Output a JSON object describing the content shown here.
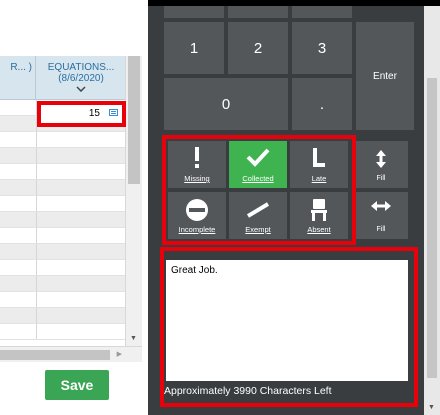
{
  "gradebook": {
    "left_column_header": "R... )",
    "column_header_title": "EQUATIONS...",
    "column_header_date": "(8/6/2020)",
    "selected_score": "15",
    "save_label": "Save"
  },
  "keypad": {
    "keys": [
      "1",
      "2",
      "3",
      "0",
      "."
    ],
    "enter_label": "Enter"
  },
  "status_buttons": [
    {
      "label": "Missing",
      "icon": "exclamation-icon",
      "active": false
    },
    {
      "label": "Collected",
      "icon": "checkmark-icon",
      "active": true
    },
    {
      "label": "Late",
      "icon": "late-icon",
      "active": false
    },
    {
      "label": "Incomplete",
      "icon": "incomplete-icon",
      "active": false
    },
    {
      "label": "Exempt",
      "icon": "exempt-icon",
      "active": false
    },
    {
      "label": "Absent",
      "icon": "chair-icon",
      "active": false
    }
  ],
  "fill_buttons": [
    {
      "label": "Fill",
      "icon": "vertical-arrows-icon"
    },
    {
      "label": "Fill",
      "icon": "horizontal-arrows-icon"
    }
  ],
  "comment": {
    "text": "Great Job.",
    "chars_left": "Approximately 3990 Characters Left"
  },
  "colors": {
    "dark_panel": "#3a3d40",
    "key_bg": "#54575a",
    "active_green": "#3fb34f",
    "highlight_red": "#e8000b",
    "save_green": "#3aa655"
  }
}
